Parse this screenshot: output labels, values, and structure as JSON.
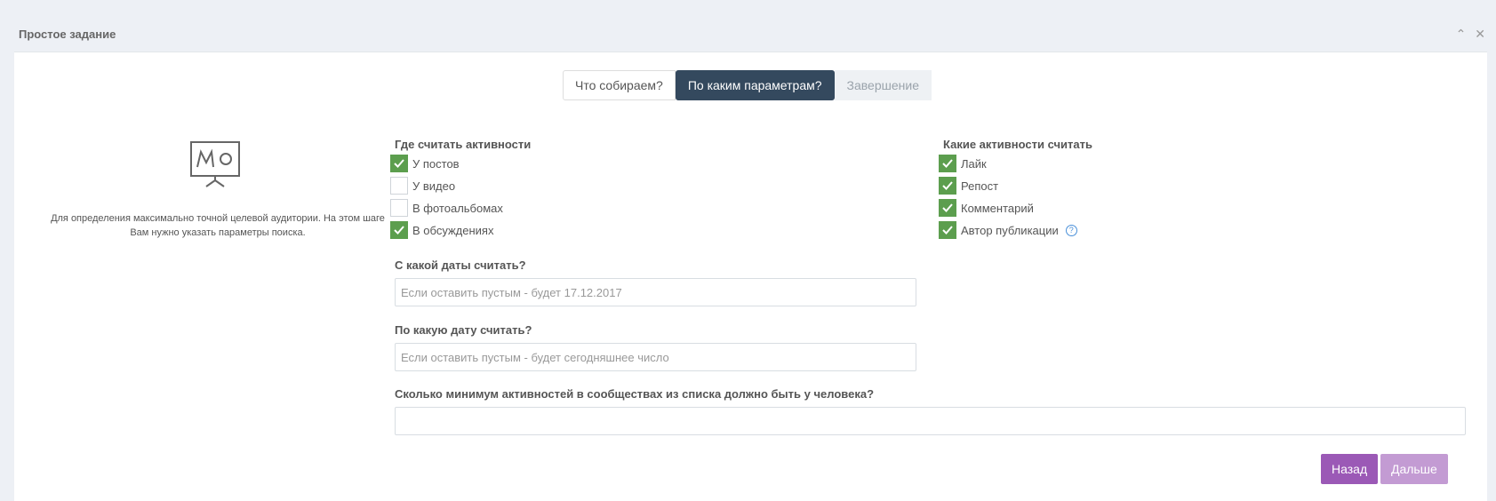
{
  "panel": {
    "title": "Простое задание"
  },
  "steps": [
    {
      "label": "Что собираем?",
      "state": "normal"
    },
    {
      "label": "По каким параметрам?",
      "state": "active"
    },
    {
      "label": "Завершение",
      "state": "disabled"
    }
  ],
  "intro": {
    "icon": "presentation-board-icon",
    "text": "Для определения максимально точной целевой аудитории. На этом шаге Вам нужно указать параметры поиска."
  },
  "where": {
    "label": "Где считать активности",
    "items": [
      {
        "label": "У постов",
        "checked": true
      },
      {
        "label": "У видео",
        "checked": false
      },
      {
        "label": "В фотоальбомах",
        "checked": false
      },
      {
        "label": "В обсуждениях",
        "checked": true
      }
    ]
  },
  "which": {
    "label": "Какие активности считать",
    "items": [
      {
        "label": "Лайк",
        "checked": true
      },
      {
        "label": "Репост",
        "checked": true
      },
      {
        "label": "Комментарий",
        "checked": true
      },
      {
        "label": "Автор публикации",
        "checked": true,
        "help": true
      }
    ]
  },
  "date_from": {
    "label": "С какой даты считать?",
    "placeholder": "Если оставить пустым - будет 17.12.2017",
    "value": ""
  },
  "date_to": {
    "label": "По какую дату считать?",
    "placeholder": "Если оставить пустым - будет сегодняшнее число",
    "value": ""
  },
  "min_activity": {
    "label": "Сколько минимум активностей в сообществах из списка должно быть у человека?",
    "placeholder": "",
    "value": ""
  },
  "buttons": {
    "back": "Назад",
    "next": "Дальше"
  },
  "colors": {
    "active_step": "#34495e",
    "checkbox_checked": "#5c9e4e",
    "back_button": "#9b59b6",
    "next_button": "#c39bd3"
  }
}
